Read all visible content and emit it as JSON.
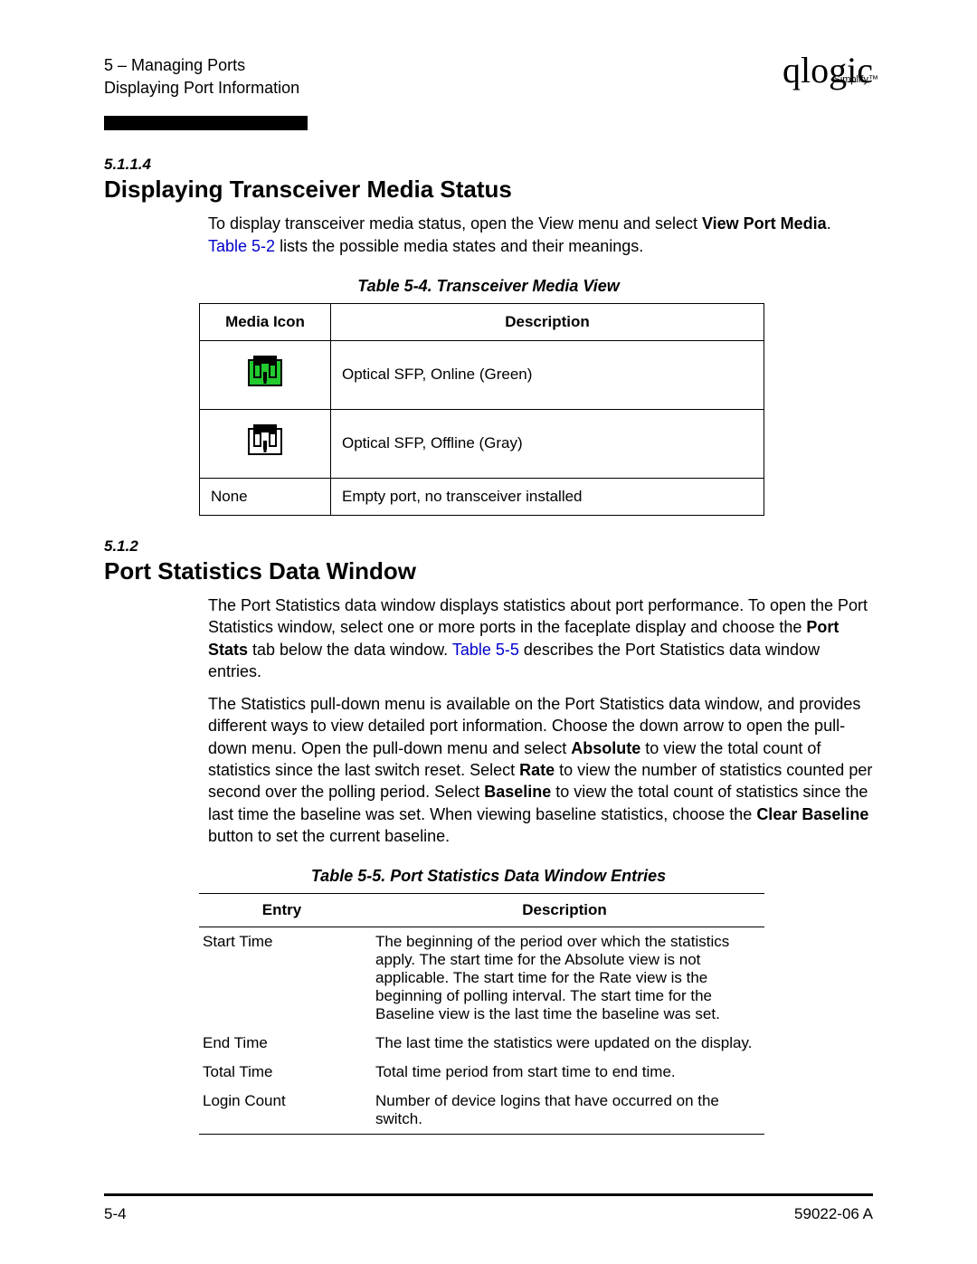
{
  "header": {
    "chapter": "5 – Managing Ports",
    "subsection": "Displaying Port Information",
    "logo_main": "qlogic",
    "logo_sub": "Simplify™"
  },
  "s1": {
    "num": "5.1.1.4",
    "title": "Displaying Transceiver Media Status",
    "p1_a": "To display transceiver media status, open the View menu and select ",
    "p1_b": "View Port Media",
    "p1_c": ". ",
    "p1_link": "Table 5-2",
    "p1_d": " lists the possible media states and their meanings."
  },
  "table4": {
    "caption": "Table 5-4. Transceiver Media View",
    "h1": "Media Icon",
    "h2": "Description",
    "rows": [
      {
        "icon": "green",
        "desc": "Optical SFP, Online (Green)"
      },
      {
        "icon": "gray",
        "desc": "Optical SFP, Offline (Gray)"
      },
      {
        "icon": "none",
        "label": "None",
        "desc": "Empty port, no transceiver installed"
      }
    ]
  },
  "s2": {
    "num": "5.1.2",
    "title": "Port Statistics Data Window",
    "p1_a": "The Port Statistics data window displays statistics about port performance. To open the Port Statistics window, select one or more ports in the faceplate display and choose the ",
    "p1_b": "Port Stats",
    "p1_c": " tab below the data window. ",
    "p1_link": "Table 5-5",
    "p1_d": " describes the Port Statistics data window entries.",
    "p2_a": "The Statistics pull-down menu is available on the Port Statistics data window, and provides different ways to view detailed port information. Choose the down arrow to open the pull-down menu. Open the pull-down menu and select ",
    "p2_b": "Absolute",
    "p2_c": " to view the total count of statistics since the last switch reset. Select ",
    "p2_d": "Rate",
    "p2_e": " to view the number of statistics counted per second over the polling period. Select ",
    "p2_f": "Baseline",
    "p2_g": " to view the total count of statistics since the last time the baseline was set. When viewing baseline statistics, choose the ",
    "p2_h": "Clear Baseline",
    "p2_i": " button to set the current baseline."
  },
  "table5": {
    "caption": "Table 5-5. Port Statistics Data Window Entries",
    "h1": "Entry",
    "h2": "Description",
    "rows": [
      {
        "entry": "Start Time",
        "desc": "The beginning of the period over which the statistics apply. The start time for the Absolute view is not applicable. The start time for the Rate view is the beginning of polling interval. The start time for the Baseline view is the last time the baseline was set."
      },
      {
        "entry": "End Time",
        "desc": "The last time the statistics were updated on the display."
      },
      {
        "entry": "Total Time",
        "desc": "Total time period from start time to end time."
      },
      {
        "entry": "Login Count",
        "desc": "Number of device logins that have occurred on the switch."
      }
    ]
  },
  "footer": {
    "left": "5-4",
    "right": "59022-06 A"
  }
}
